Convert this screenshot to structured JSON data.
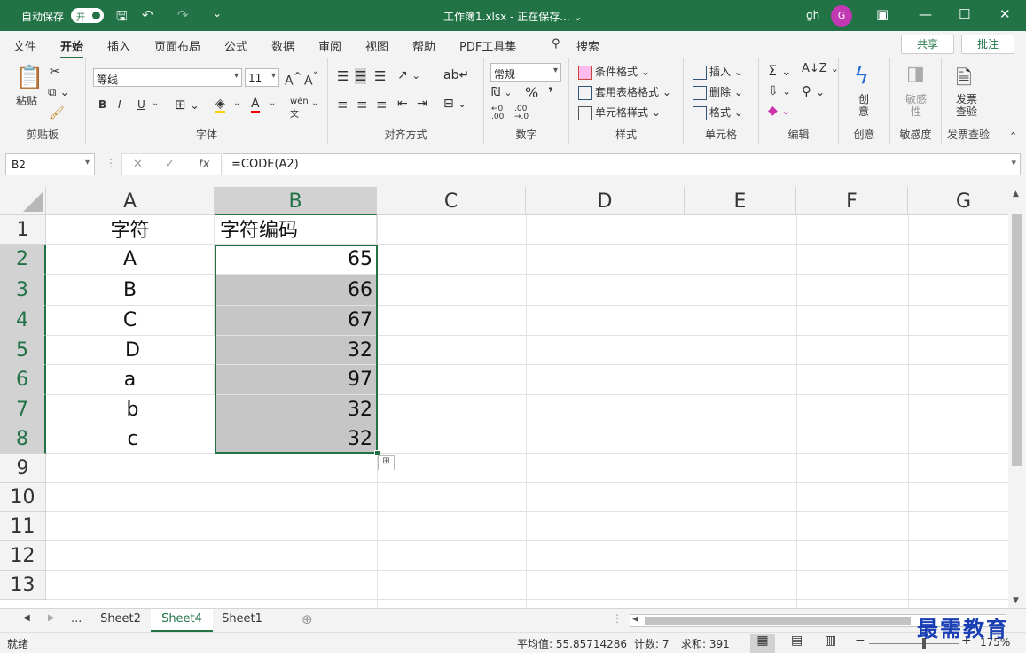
{
  "titlebar": {
    "autosave": "自动保存",
    "toggle": "开",
    "title": "工作簿1.xlsx - 正在保存... ⌄",
    "user": "gh",
    "avatar": "G"
  },
  "menu": [
    "文件",
    "开始",
    "插入",
    "页面布局",
    "公式",
    "数据",
    "审阅",
    "视图",
    "帮助",
    "PDF工具集",
    "搜索"
  ],
  "share": "共享",
  "comment": "批注",
  "ribbon": {
    "clipboard": {
      "paste": "粘贴",
      "label": "剪贴板"
    },
    "font": {
      "name": "等线",
      "size": "11",
      "label": "字体",
      "bold": "B",
      "italic": "I",
      "underline": "U"
    },
    "align": {
      "label": "对齐方式"
    },
    "number": {
      "format": "常规",
      "label": "数字"
    },
    "styles": {
      "cond": "条件格式",
      "table": "套用表格格式",
      "cell": "单元格样式",
      "label": "样式"
    },
    "cells": {
      "insert": "插入",
      "delete": "删除",
      "format": "格式",
      "label": "单元格"
    },
    "edit": {
      "label": "编辑"
    },
    "creative": {
      "btn": "创\n意",
      "label": "创意"
    },
    "sensitive": {
      "btn": "敏感\n性",
      "label": "敏感度"
    },
    "invoice": {
      "btn": "发票\n查验",
      "label": "发票查验"
    }
  },
  "namebox": "B2",
  "formula": "=CODE(A2)",
  "columns": [
    "A",
    "B",
    "C",
    "D",
    "E",
    "F",
    "G"
  ],
  "rows": [
    "1",
    "2",
    "3",
    "4",
    "5",
    "6",
    "7",
    "8",
    "9",
    "10",
    "11",
    "12",
    "13"
  ],
  "cells": {
    "A": [
      "字符",
      "A",
      "B",
      "C",
      "D",
      "a",
      "b",
      "c"
    ],
    "B": [
      "字符编码",
      "65",
      "66",
      "67",
      "32",
      "97",
      "32",
      "32"
    ]
  },
  "sheets": [
    "Sheet2",
    "Sheet4",
    "Sheet1"
  ],
  "status": {
    "ready": "就绪",
    "avg": "平均值: 55.85714286",
    "count": "计数: 7",
    "sum": "求和: 391",
    "zoom": "175%"
  },
  "watermark": "最需教育"
}
